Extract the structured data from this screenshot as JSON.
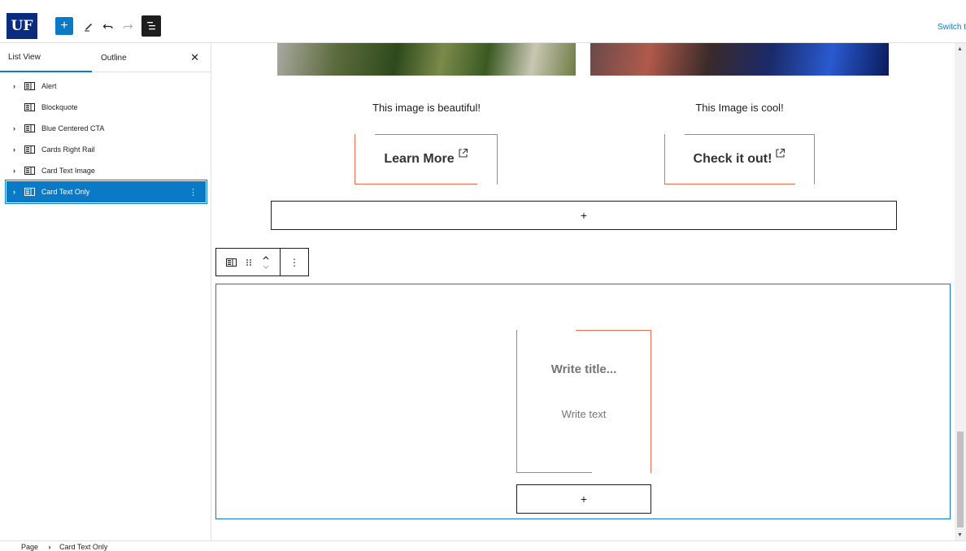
{
  "topbar": {
    "logo_text": "UF",
    "add_icon": "plus-icon",
    "tools": [
      "pencil-icon",
      "undo-icon",
      "redo-icon",
      "list-view-icon"
    ],
    "switch_label": "Switch t"
  },
  "sidebar": {
    "tabs": [
      {
        "label": "List View",
        "active": true
      },
      {
        "label": "Outline",
        "active": false
      }
    ],
    "close_icon": "close-icon",
    "items": [
      {
        "label": "Alert",
        "expandable": true,
        "selected": false
      },
      {
        "label": "Blockquote",
        "expandable": false,
        "selected": false
      },
      {
        "label": "Blue Centered CTA",
        "expandable": true,
        "selected": false
      },
      {
        "label": "Cards Right Rail",
        "expandable": true,
        "selected": false
      },
      {
        "label": "Card Text Image",
        "expandable": true,
        "selected": false
      },
      {
        "label": "Card Text Only",
        "expandable": true,
        "selected": true
      }
    ]
  },
  "canvas": {
    "captions": [
      "This image is beautiful!",
      "This Image is cool!"
    ],
    "buttons": [
      "Learn More",
      "Check it out!"
    ],
    "appender_symbol": "+",
    "card": {
      "title_placeholder": "Write title...",
      "text_placeholder": "Write text"
    }
  },
  "breadcrumb": {
    "root": "Page",
    "separator": "›",
    "current": "Card Text Only"
  },
  "colors": {
    "accent": "#0a7ac6",
    "logo_bg": "#0a2b7e",
    "card_border": "#f06a4a"
  }
}
